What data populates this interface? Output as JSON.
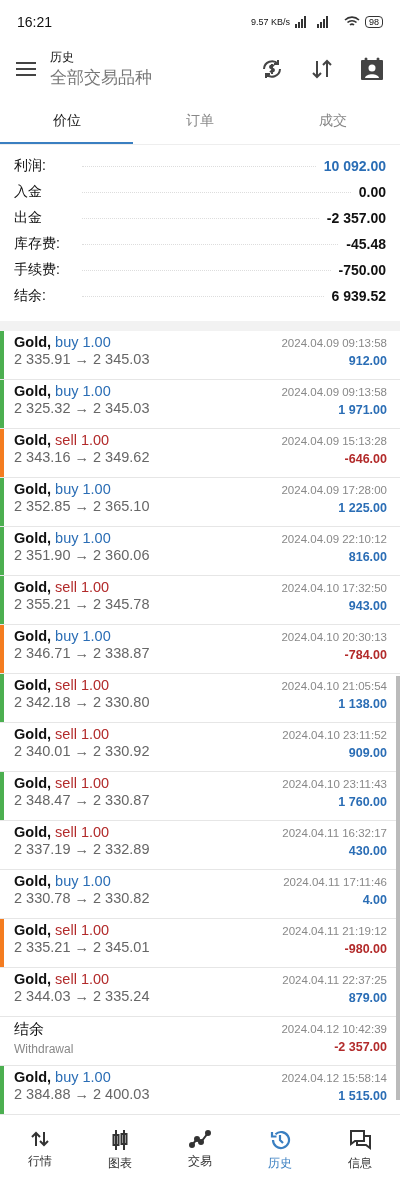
{
  "status_bar": {
    "time": "16:21",
    "speed": "9.57 KB/s",
    "battery": "98"
  },
  "header": {
    "title": "历史",
    "subtitle": "全部交易品种"
  },
  "tabs": [
    {
      "label": "价位",
      "selected": true
    },
    {
      "label": "订单",
      "selected": false
    },
    {
      "label": "成交",
      "selected": false
    }
  ],
  "summary": [
    {
      "label": "利润:",
      "value": "10 092.00",
      "highlight": true
    },
    {
      "label": "入金",
      "value": "0.00",
      "highlight": false
    },
    {
      "label": "出金",
      "value": "-2 357.00",
      "highlight": false
    },
    {
      "label": "库存费:",
      "value": "-45.48",
      "highlight": false
    },
    {
      "label": "手续费:",
      "value": "-750.00",
      "highlight": false
    },
    {
      "label": "结余:",
      "value": "6 939.52",
      "highlight": false
    }
  ],
  "deals": [
    {
      "kind": "trade",
      "symbol": "Gold,",
      "side": "buy",
      "volume": "1.00",
      "prices": "2 335.91 → 2 345.03",
      "time": "2024.04.09 09:13:58",
      "profit": "912.00",
      "positive": true,
      "color": "#4caf50"
    },
    {
      "kind": "trade",
      "symbol": "Gold,",
      "side": "buy",
      "volume": "1.00",
      "prices": "2 325.32 → 2 345.03",
      "time": "2024.04.09 09:13:58",
      "profit": "1 971.00",
      "positive": true,
      "color": "#4caf50"
    },
    {
      "kind": "trade",
      "symbol": "Gold,",
      "side": "sell",
      "volume": "1.00",
      "prices": "2 343.16 → 2 349.62",
      "time": "2024.04.09 15:13:28",
      "profit": "-646.00",
      "positive": false,
      "color": "#f47c20"
    },
    {
      "kind": "trade",
      "symbol": "Gold,",
      "side": "buy",
      "volume": "1.00",
      "prices": "2 352.85 → 2 365.10",
      "time": "2024.04.09 17:28:00",
      "profit": "1 225.00",
      "positive": true,
      "color": "#4caf50"
    },
    {
      "kind": "trade",
      "symbol": "Gold,",
      "side": "buy",
      "volume": "1.00",
      "prices": "2 351.90 → 2 360.06",
      "time": "2024.04.09 22:10:12",
      "profit": "816.00",
      "positive": true,
      "color": "#4caf50"
    },
    {
      "kind": "trade",
      "symbol": "Gold,",
      "side": "sell",
      "volume": "1.00",
      "prices": "2 355.21 → 2 345.78",
      "time": "2024.04.10 17:32:50",
      "profit": "943.00",
      "positive": true,
      "color": "#4caf50"
    },
    {
      "kind": "trade",
      "symbol": "Gold,",
      "side": "buy",
      "volume": "1.00",
      "prices": "2 346.71 → 2 338.87",
      "time": "2024.04.10 20:30:13",
      "profit": "-784.00",
      "positive": false,
      "color": "#f47c20"
    },
    {
      "kind": "trade",
      "symbol": "Gold,",
      "side": "sell",
      "volume": "1.00",
      "prices": "2 342.18 → 2 330.80",
      "time": "2024.04.10 21:05:54",
      "profit": "1 138.00",
      "positive": true,
      "color": "#4caf50"
    },
    {
      "kind": "trade",
      "symbol": "Gold,",
      "side": "sell",
      "volume": "1.00",
      "prices": "2 340.01 → 2 330.92",
      "time": "2024.04.10 23:11:52",
      "profit": "909.00",
      "positive": true
    },
    {
      "kind": "trade",
      "symbol": "Gold,",
      "side": "sell",
      "volume": "1.00",
      "prices": "2 348.47 → 2 330.87",
      "time": "2024.04.10 23:11:43",
      "profit": "1 760.00",
      "positive": true,
      "color": "#4caf50"
    },
    {
      "kind": "trade",
      "symbol": "Gold,",
      "side": "sell",
      "volume": "1.00",
      "prices": "2 337.19 → 2 332.89",
      "time": "2024.04.11 16:32:17",
      "profit": "430.00",
      "positive": true
    },
    {
      "kind": "trade",
      "symbol": "Gold,",
      "side": "buy",
      "volume": "1.00",
      "prices": "2 330.78 → 2 330.82",
      "time": "2024.04.11 17:11:46",
      "profit": "4.00",
      "positive": true
    },
    {
      "kind": "trade",
      "symbol": "Gold,",
      "side": "sell",
      "volume": "1.00",
      "prices": "2 335.21 → 2 345.01",
      "time": "2024.04.11 21:19:12",
      "profit": "-980.00",
      "positive": false,
      "color": "#f47c20"
    },
    {
      "kind": "trade",
      "symbol": "Gold,",
      "side": "sell",
      "volume": "1.00",
      "prices": "2 344.03 → 2 335.24",
      "time": "2024.04.11 22:37:25",
      "profit": "879.00",
      "positive": true
    },
    {
      "kind": "balance",
      "title": "结余",
      "note": "Withdrawal",
      "time": "2024.04.12 10:42:39",
      "profit": "-2 357.00",
      "positive": false
    },
    {
      "kind": "trade",
      "symbol": "Gold,",
      "side": "buy",
      "volume": "1.00",
      "prices": "2 384.88 → 2 400.03",
      "time": "2024.04.12 15:58:14",
      "profit": "1 515.00",
      "positive": true,
      "color": "#4caf50"
    }
  ],
  "nav": [
    {
      "label": "行情",
      "selected": false
    },
    {
      "label": "图表",
      "selected": false
    },
    {
      "label": "交易",
      "selected": false
    },
    {
      "label": "历史",
      "selected": true
    },
    {
      "label": "信息",
      "selected": false
    }
  ]
}
